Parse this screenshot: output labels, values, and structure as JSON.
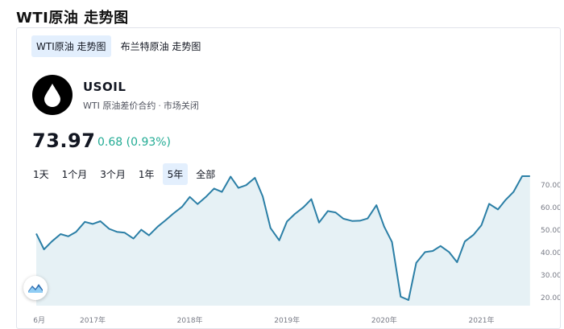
{
  "heading": "WTI原油 走势图",
  "tabs": [
    {
      "label": "WTI原油 走势图",
      "active": true
    },
    {
      "label": "布兰特原油 走势图",
      "active": false
    }
  ],
  "instrument": {
    "symbol": "USOIL",
    "description": "WTI 原油差价合约",
    "separator": "·",
    "market_status": "市场关闭",
    "price": "73.97",
    "change": "0.68 (0.93%)",
    "logo_icon": "oil-drop-icon"
  },
  "ranges": [
    {
      "label": "1天",
      "active": false
    },
    {
      "label": "1个月",
      "active": false
    },
    {
      "label": "3个月",
      "active": false
    },
    {
      "label": "1年",
      "active": false
    },
    {
      "label": "5年",
      "active": true
    },
    {
      "label": "全部",
      "active": false
    }
  ],
  "colors": {
    "line": "#2b7fa6",
    "area": "#e6f1f5",
    "accent_positive": "#22ab94",
    "active_tab_bg": "#e3effd"
  },
  "chart_data": {
    "type": "area",
    "x_tick_labels": [
      "6月",
      "2017年",
      "2018年",
      "2019年",
      "2020年",
      "2021年"
    ],
    "x_ticks": [
      2016.45,
      2017.0,
      2018.0,
      2019.0,
      2020.0,
      2021.0
    ],
    "xlim": [
      2016.42,
      2021.56
    ],
    "y_tick_labels": [
      "70.00",
      "60.00",
      "50.00",
      "40.00",
      "30.00",
      "20.00"
    ],
    "y_ticks": [
      70,
      60,
      50,
      40,
      30,
      20
    ],
    "ylim": [
      16.5,
      79
    ],
    "series": [
      {
        "x": [
          2016.42,
          2016.5,
          2016.58,
          2016.67,
          2016.75,
          2016.83,
          2016.92,
          2017.0,
          2017.08,
          2017.17,
          2017.25,
          2017.33,
          2017.42,
          2017.5,
          2017.58,
          2017.67,
          2017.75,
          2017.83,
          2017.92,
          2018.0,
          2018.08,
          2018.17,
          2018.25,
          2018.33,
          2018.42,
          2018.5,
          2018.58,
          2018.67,
          2018.75,
          2018.83,
          2018.92,
          2019.0,
          2019.08,
          2019.17,
          2019.25,
          2019.33,
          2019.42,
          2019.5,
          2019.58,
          2019.67,
          2019.75,
          2019.83,
          2019.92,
          2020.0,
          2020.08,
          2020.17,
          2020.25,
          2020.33,
          2020.42,
          2020.5,
          2020.58,
          2020.67,
          2020.75,
          2020.83,
          2020.92,
          2021.0,
          2021.08,
          2021.17,
          2021.25,
          2021.33,
          2021.42,
          2021.5
        ],
        "y": [
          48.5,
          41.5,
          45.0,
          48.3,
          47.3,
          49.3,
          53.7,
          52.8,
          54.0,
          50.6,
          49.3,
          48.9,
          46.3,
          50.2,
          47.7,
          51.6,
          54.4,
          57.4,
          60.4,
          64.8,
          61.6,
          65.0,
          68.5,
          67.0,
          73.8,
          68.8,
          70.0,
          73.3,
          65.0,
          51.0,
          45.5,
          53.9,
          57.2,
          60.2,
          63.8,
          53.4,
          58.5,
          57.9,
          55.1,
          54.1,
          54.2,
          55.2,
          61.1,
          51.6,
          44.8,
          20.5,
          19.0,
          35.5,
          40.3,
          40.8,
          43.0,
          40.2,
          35.8,
          45.0,
          48.0,
          52.2,
          61.7,
          59.2,
          63.5,
          67.0,
          74.0,
          74.0
        ]
      }
    ]
  }
}
